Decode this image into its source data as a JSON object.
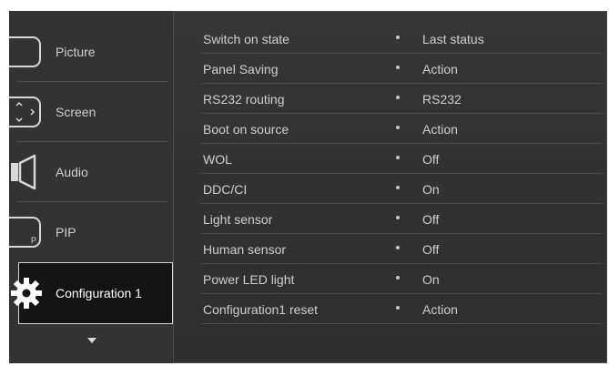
{
  "sidebar": {
    "items": [
      {
        "label": "Picture",
        "icon": "picture-icon"
      },
      {
        "label": "Screen",
        "icon": "screen-icon"
      },
      {
        "label": "Audio",
        "icon": "speaker-icon"
      },
      {
        "label": "PIP",
        "icon": "pip-icon"
      },
      {
        "label": "Configuration 1",
        "icon": "gear-icon"
      }
    ],
    "more": "down-arrow-icon"
  },
  "settings": {
    "rows": [
      {
        "name": "Switch on state",
        "value": "Last status"
      },
      {
        "name": "Panel Saving",
        "value": "Action"
      },
      {
        "name": "RS232 routing",
        "value": "RS232"
      },
      {
        "name": "Boot on source",
        "value": "Action"
      },
      {
        "name": "WOL",
        "value": "Off"
      },
      {
        "name": "DDC/CI",
        "value": "On"
      },
      {
        "name": "Light sensor",
        "value": "Off"
      },
      {
        "name": "Human sensor",
        "value": "Off"
      },
      {
        "name": "Power LED light",
        "value": "On"
      },
      {
        "name": "Configuration1 reset",
        "value": "Action"
      }
    ]
  },
  "colors": {
    "background": "#333333",
    "text": "#cfcfcf",
    "selected_bg": "#141414",
    "selected_border": "#cfd6de"
  }
}
